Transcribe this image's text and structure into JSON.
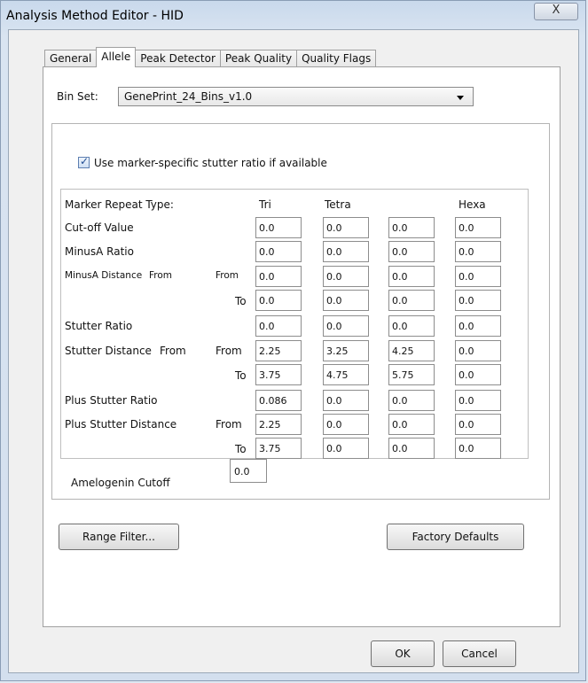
{
  "window": {
    "title": "Analysis Method Editor - HID",
    "close_glyph": "X"
  },
  "tabs": [
    {
      "label": "General",
      "active": false
    },
    {
      "label": "Allele",
      "active": true
    },
    {
      "label": "Peak Detector",
      "active": false
    },
    {
      "label": "Peak Quality",
      "active": false
    },
    {
      "label": "Quality Flags",
      "active": false
    }
  ],
  "bin_set": {
    "label": "Bin Set:",
    "value": "GenePrint_24_Bins_v1.0"
  },
  "stutter_option": {
    "label": "Use marker-specific stutter ratio if available",
    "checked": true
  },
  "marker_table": {
    "header_label": "Marker Repeat Type:",
    "columns": [
      "Tri",
      "Tetra",
      "",
      "Hexa"
    ],
    "row_labels": {
      "cutoff": "Cut-off Value",
      "minusa_ratio": "MinusA Ratio",
      "minusa_distance": "MinusA Distance",
      "minusa_from_small": "From",
      "stutter_ratio": "Stutter Ratio",
      "stutter_distance": "Stutter Distance",
      "stutter_from_inner": "From",
      "plus_stutter_ratio": "Plus Stutter Ratio",
      "plus_stutter_distance": "Plus Stutter Distance",
      "from": "From",
      "to": "To"
    },
    "values": {
      "cutoff": [
        "0.0",
        "0.0",
        "0.0",
        "0.0"
      ],
      "minusa_ratio": [
        "0.0",
        "0.0",
        "0.0",
        "0.0"
      ],
      "minusa_from": [
        "0.0",
        "0.0",
        "0.0",
        "0.0"
      ],
      "minusa_to": [
        "0.0",
        "0.0",
        "0.0",
        "0.0"
      ],
      "stutter_ratio": [
        "0.0",
        "0.0",
        "0.0",
        "0.0"
      ],
      "stutter_from": [
        "2.25",
        "3.25",
        "4.25",
        "0.0"
      ],
      "stutter_to": [
        "3.75",
        "4.75",
        "5.75",
        "0.0"
      ],
      "plus_stutter_ratio": [
        "0.086",
        "0.0",
        "0.0",
        "0.0"
      ],
      "plus_stutter_from": [
        "2.25",
        "0.0",
        "0.0",
        "0.0"
      ],
      "plus_stutter_to": [
        "3.75",
        "0.0",
        "0.0",
        "0.0"
      ]
    }
  },
  "amelogenin": {
    "label": "Amelogenin Cutoff",
    "value": "0.0"
  },
  "buttons": {
    "range_filter": "Range Filter...",
    "factory_defaults": "Factory Defaults",
    "ok": "OK",
    "cancel": "Cancel"
  }
}
